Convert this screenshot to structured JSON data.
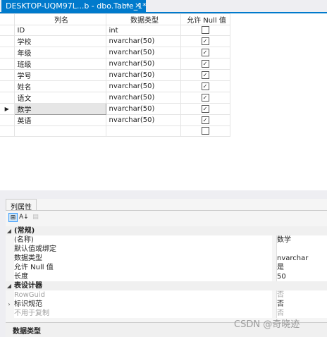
{
  "doc_tab": {
    "title": "DESKTOP-UQM97L...b - dbo.Table_1*",
    "pin_glyph": "⊸",
    "close_glyph": "×"
  },
  "designer": {
    "headers": {
      "column_name": "列名",
      "data_type": "数据类型",
      "allow_nulls": "允许 Null 值"
    },
    "current_row_glyph": "▶",
    "rows": [
      {
        "name": "ID",
        "type": "int",
        "allow_null": false
      },
      {
        "name": "学校",
        "type": "nvarchar(50)",
        "allow_null": true
      },
      {
        "name": "年级",
        "type": "nvarchar(50)",
        "allow_null": true
      },
      {
        "name": "班级",
        "type": "nvarchar(50)",
        "allow_null": true
      },
      {
        "name": "学号",
        "type": "nvarchar(50)",
        "allow_null": true
      },
      {
        "name": "姓名",
        "type": "nvarchar(50)",
        "allow_null": true
      },
      {
        "name": "语文",
        "type": "nvarchar(50)",
        "allow_null": true
      },
      {
        "name": "数学",
        "type": "nvarchar(50)",
        "allow_null": true,
        "current": true
      },
      {
        "name": "英语",
        "type": "nvarchar(50)",
        "allow_null": true
      },
      {
        "name": "",
        "type": "",
        "allow_null": false
      }
    ]
  },
  "properties": {
    "tab_label": "列属性",
    "toolbar": {
      "categorized": "⊞",
      "alphabetical": "A↓",
      "pages": "▤"
    },
    "rows": [
      {
        "kind": "cat",
        "expander": "◢",
        "name": "(常规)",
        "value": ""
      },
      {
        "kind": "item",
        "name": "(名称)",
        "value": "数学"
      },
      {
        "kind": "item",
        "name": "默认值或绑定",
        "value": ""
      },
      {
        "kind": "item",
        "name": "数据类型",
        "value": "nvarchar"
      },
      {
        "kind": "item",
        "name": "允许 Null 值",
        "value": "是"
      },
      {
        "kind": "item",
        "name": "长度",
        "value": "50"
      },
      {
        "kind": "cat",
        "expander": "◢",
        "name": "表设计器",
        "value": ""
      },
      {
        "kind": "item",
        "dim": true,
        "name": "RowGuid",
        "value": "否"
      },
      {
        "kind": "item",
        "expander": "›",
        "name": "标识规范",
        "value": "否"
      },
      {
        "kind": "item",
        "dim": true,
        "name": "不用于复制",
        "value": "否"
      }
    ],
    "description_title": "数据类型"
  },
  "watermark": "CSDN @奇晓迹",
  "colors": {
    "accent": "#007acc",
    "panel": "#eeeef2",
    "selection": "#cce4f7"
  }
}
